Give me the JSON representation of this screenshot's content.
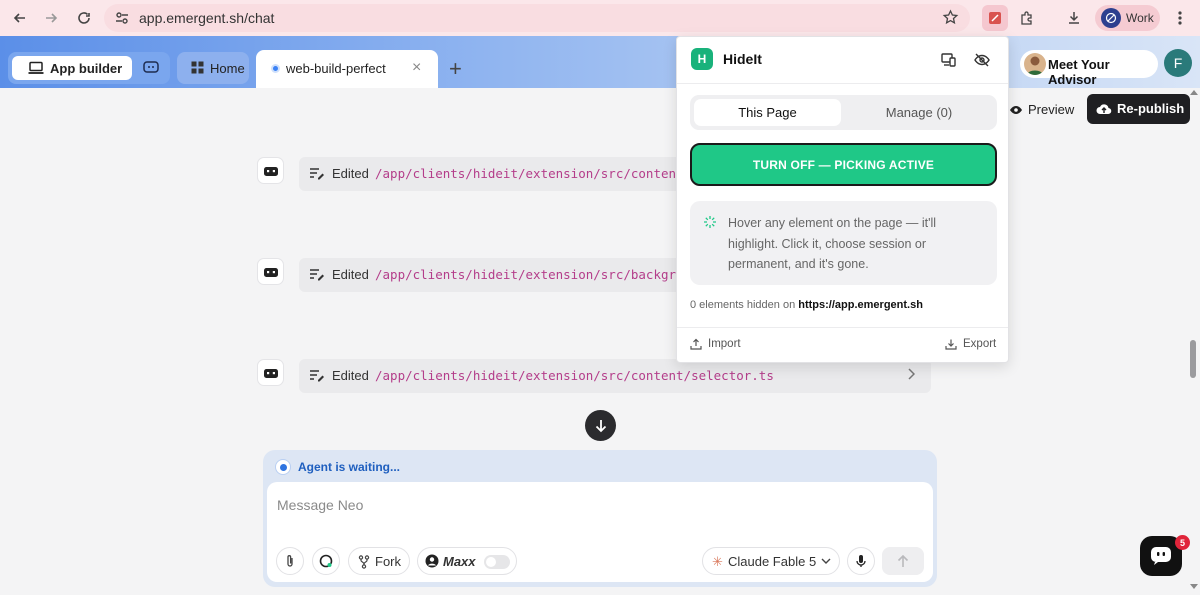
{
  "browser": {
    "url": "app.emergent.sh/chat",
    "profile_label": "Work",
    "icons": [
      "back-icon",
      "forward-icon",
      "reload-icon",
      "site-info-icon",
      "star-icon",
      "extension-hideit-icon",
      "extensions-puzzle-icon",
      "download-icon",
      "menu-dots-icon"
    ]
  },
  "header": {
    "app_builder_label": "App builder",
    "home_label": "Home",
    "active_tab_label": "web-build-perfect",
    "tab_close": "×",
    "tab_add": "+",
    "advisor_label": "Meet Your Advisor",
    "user_initial": "F"
  },
  "toolbar": {
    "preview_label": "Preview",
    "republish_label": "Re-publish"
  },
  "edits": [
    {
      "verb": "Edited",
      "path": "/app/clients/hideit/extension/src/content"
    },
    {
      "verb": "Edited",
      "path": "/app/clients/hideit/extension/src/backgro"
    },
    {
      "verb": "Edited",
      "path": "/app/clients/hideit/extension/src/content/selector.ts"
    }
  ],
  "composer": {
    "status": "Agent is waiting...",
    "placeholder": "Message Neo",
    "fork_label": "Fork",
    "maxx_label": "Maxx",
    "model_label": "Claude Fable 5"
  },
  "chat_widget": {
    "badge_count": "5"
  },
  "popup": {
    "title": "HideIt",
    "logo_letter": "H",
    "tab_this_page": "This Page",
    "tab_manage": "Manage (0)",
    "turn_off_label": "TURN OFF — PICKING ACTIVE",
    "hint": "Hover any element on the page — it'll highlight. Click it, choose session or permanent, and it's gone.",
    "hidden_count_prefix": "0 elements hidden on ",
    "hidden_host": "https://app.emergent.sh",
    "import_label": "Import",
    "export_label": "Export"
  },
  "colors": {
    "accent_green": "#1fc887",
    "brand_blue": "#5b8fe8",
    "path_magenta": "#b43d8a",
    "chrome_pink": "#fbe7ea"
  }
}
